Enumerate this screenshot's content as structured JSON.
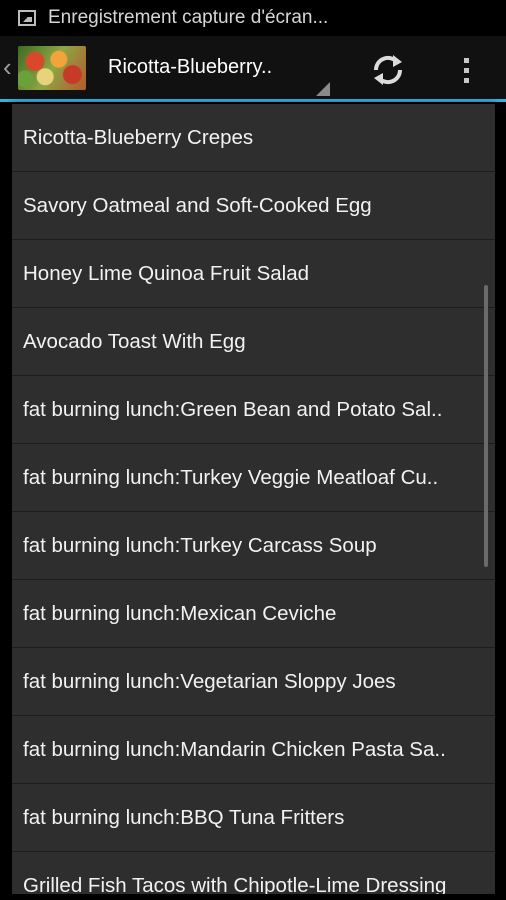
{
  "status_bar": {
    "notification_text": "Enregistrement capture d'écran..."
  },
  "action_bar": {
    "spinner_title": "Ricotta-Blueberry..",
    "thumbnail_icon": "food-thumbnail-icon",
    "refresh_icon": "refresh-icon",
    "overflow_icon": "overflow-menu-icon",
    "accent_color": "#2fb3e0"
  },
  "dropdown": {
    "items": [
      {
        "label": "Ricotta-Blueberry Crepes"
      },
      {
        "label": "Savory Oatmeal and Soft-Cooked Egg"
      },
      {
        "label": "Honey Lime Quinoa Fruit Salad"
      },
      {
        "label": "Avocado Toast With Egg"
      },
      {
        "label": "fat burning lunch:Green Bean and Potato Sal.."
      },
      {
        "label": "fat burning lunch:Turkey Veggie Meatloaf Cu.."
      },
      {
        "label": "fat burning lunch:Turkey Carcass Soup"
      },
      {
        "label": "fat burning lunch:Mexican Ceviche"
      },
      {
        "label": "fat burning lunch:Vegetarian Sloppy Joes"
      },
      {
        "label": "fat burning lunch:Mandarin Chicken Pasta Sa.."
      },
      {
        "label": "fat burning lunch:BBQ Tuna Fritters"
      },
      {
        "label": "Grilled Fish Tacos with Chipotle-Lime Dressing"
      }
    ]
  }
}
